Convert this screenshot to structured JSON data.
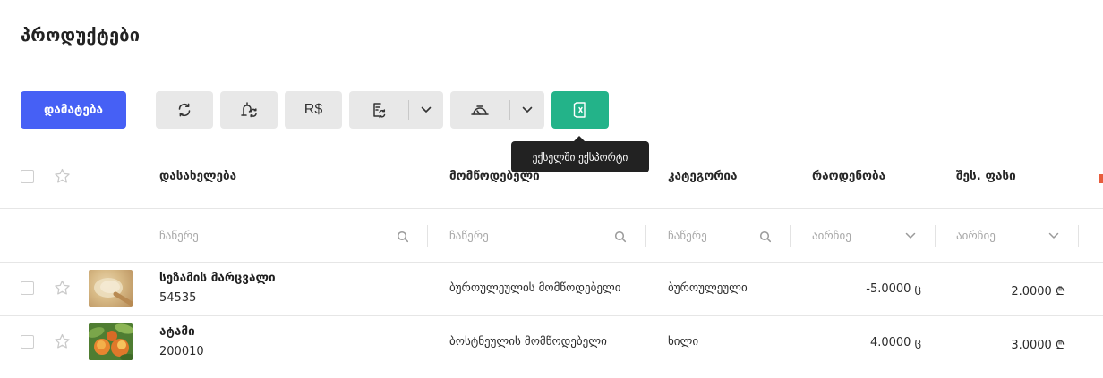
{
  "page": {
    "title": "პროდუქტები"
  },
  "toolbar": {
    "add_label": "დამატება",
    "buttons": [
      {
        "icon": "refresh-icon"
      },
      {
        "icon": "price-sync-icon"
      },
      {
        "icon": "currency-rs-icon",
        "text": "R$"
      },
      {
        "icon": "document-sync-icon",
        "has_dropdown": true
      },
      {
        "icon": "scale-icon",
        "has_dropdown": true
      },
      {
        "icon": "excel-export-icon",
        "color": "#23b389"
      }
    ],
    "tooltip": "ექსელში ექსპორტი"
  },
  "table": {
    "columns": [
      "დასახელება",
      "მომწოდებელი",
      "კატეგორია",
      "რაოდენობა",
      "შეს. ფასი"
    ],
    "filters": {
      "name_placeholder": "ჩაწერე",
      "supplier_placeholder": "ჩაწერე",
      "category_placeholder": "ჩაწერე",
      "quantity_select": "აირჩიე",
      "price_select": "აირჩიე"
    },
    "rows": [
      {
        "name": "სეზამის მარცვალი",
        "code": "54535",
        "supplier": "ბუროულეულის მომწოდებელი",
        "category": "ბუროულეული",
        "quantity": "-5.0000 ც",
        "price": "2.0000 ₾",
        "thumb": "sesame"
      },
      {
        "name": "ატამი",
        "code": "200010",
        "supplier": "ბოსტნეულის მომწოდებელი",
        "category": "ხილი",
        "quantity": "4.0000 ც",
        "price": "3.0000 ₾",
        "thumb": "peach"
      }
    ]
  },
  "colors": {
    "primary": "#4660f5",
    "export": "#23b389",
    "button_gray": "#e8e8e8"
  }
}
